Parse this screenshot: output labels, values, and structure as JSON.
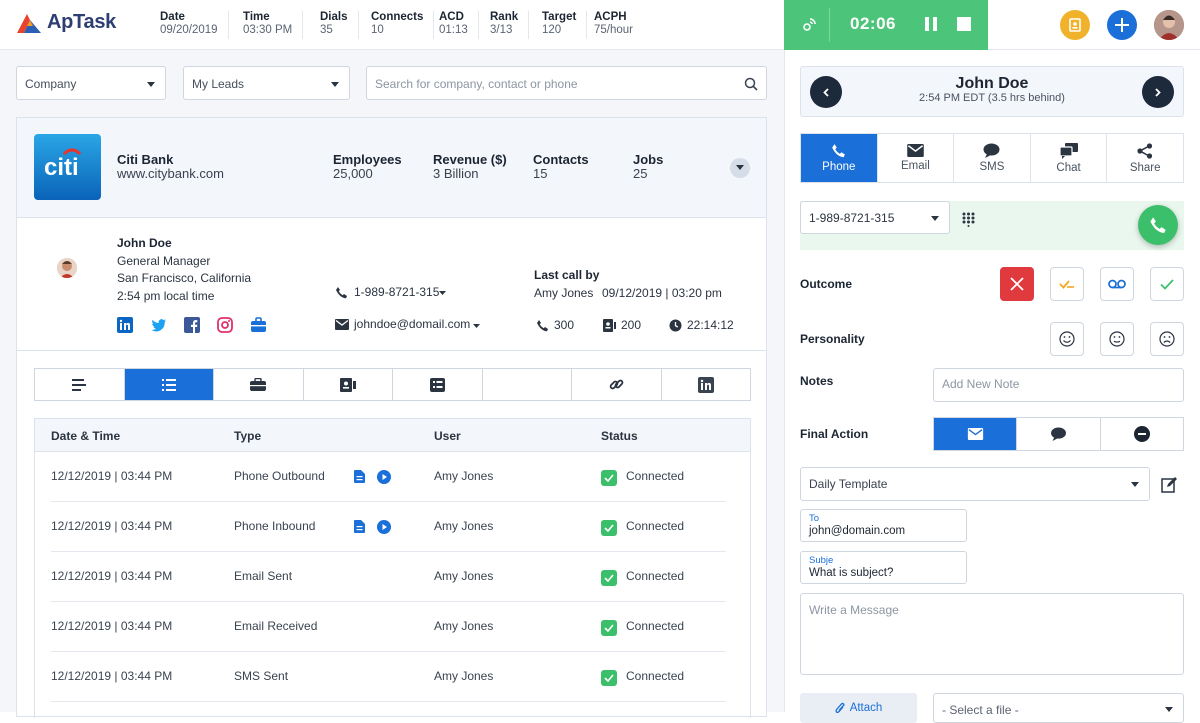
{
  "app": {
    "name": "ApTask"
  },
  "stats": [
    {
      "label": "Date",
      "value": "09/20/2019"
    },
    {
      "label": "Time",
      "value": "03:30 PM"
    },
    {
      "label": "Dials",
      "value": "35"
    },
    {
      "label": "Connects",
      "value": "10"
    },
    {
      "label": "ACD",
      "value": "01:13"
    },
    {
      "label": "Rank",
      "value": "3/13"
    },
    {
      "label": "Target",
      "value": "120"
    },
    {
      "label": "ACPH",
      "value": "75/hour"
    }
  ],
  "call": {
    "timer": "02:06"
  },
  "colors": {
    "accent": "#1a6fd8",
    "call_green": "#4cc47a",
    "danger": "#e0393e",
    "warn": "#f5a623",
    "dark": "#1d2a3b"
  },
  "filters": {
    "company": "Company",
    "leads": "My Leads",
    "search_placeholder": "Search for company, contact or phone"
  },
  "company": {
    "name": "Citi Bank",
    "website": "www.citybank.com",
    "logo_text": "citi",
    "metrics": [
      {
        "label": "Employees",
        "value": "25,000"
      },
      {
        "label": "Revenue ($)",
        "value": "3 Billion"
      },
      {
        "label": "Contacts",
        "value": "15"
      },
      {
        "label": "Jobs",
        "value": "25"
      }
    ]
  },
  "contact": {
    "name": "John Doe",
    "title": "General Manager",
    "location": "San Francisco, California",
    "local_time": "2:54 pm local time",
    "phone": "1-989-8721-315",
    "email": "johndoe@domail.com",
    "last_call_label": "Last call by",
    "last_call_user": "Amy Jones",
    "last_call_date": "09/12/2019 | 03:20 pm",
    "calls": "300",
    "cards": "200",
    "duration": "22:14:12",
    "social": [
      "linkedin-icon",
      "twitter-icon",
      "facebook-icon",
      "instagram-icon",
      "briefcase-icon"
    ]
  },
  "activity": {
    "tabs": [
      "summary-icon",
      "list-icon",
      "briefcase-icon",
      "contact-card-icon",
      "checklist-icon",
      "",
      "link-icon",
      "linkedin-icon"
    ],
    "columns": [
      "Date & Time",
      "Type",
      "User",
      "Status"
    ],
    "rows": [
      {
        "date": "12/12/2019  |  03:44 PM",
        "type": "Phone Outbound",
        "user": "Amy Jones",
        "status": "Connected",
        "media": true
      },
      {
        "date": "12/12/2019  |  03:44 PM",
        "type": "Phone Inbound",
        "user": "Amy Jones",
        "status": "Connected",
        "media": true
      },
      {
        "date": "12/12/2019  |  03:44 PM",
        "type": "Email Sent",
        "user": "Amy Jones",
        "status": "Connected",
        "media": false
      },
      {
        "date": "12/12/2019  |  03:44 PM",
        "type": "Email Received",
        "user": "Amy Jones",
        "status": "Connected",
        "media": false
      },
      {
        "date": "12/12/2019  |  03:44 PM",
        "type": "SMS Sent",
        "user": "Amy Jones",
        "status": "Connected",
        "media": false
      }
    ]
  },
  "right": {
    "contact_name": "John Doe",
    "contact_time": "2:54 PM EDT (3.5 hrs behind)",
    "tabs": [
      "Phone",
      "Email",
      "SMS",
      "Chat",
      "Share"
    ],
    "phone_number": "1-989-8721-315",
    "outcome_label": "Outcome",
    "personality_label": "Personality",
    "notes_label": "Notes",
    "notes_placeholder": "Add New Note",
    "final_action_label": "Final Action",
    "template": "Daily Template",
    "to_label": "To",
    "to_value": "john@domain.com",
    "subject_label": "Subje",
    "subject_value": "What is subject?",
    "message_placeholder": "Write a Message",
    "attach_label": "Attach",
    "file_placeholder": "- Select a file -"
  }
}
